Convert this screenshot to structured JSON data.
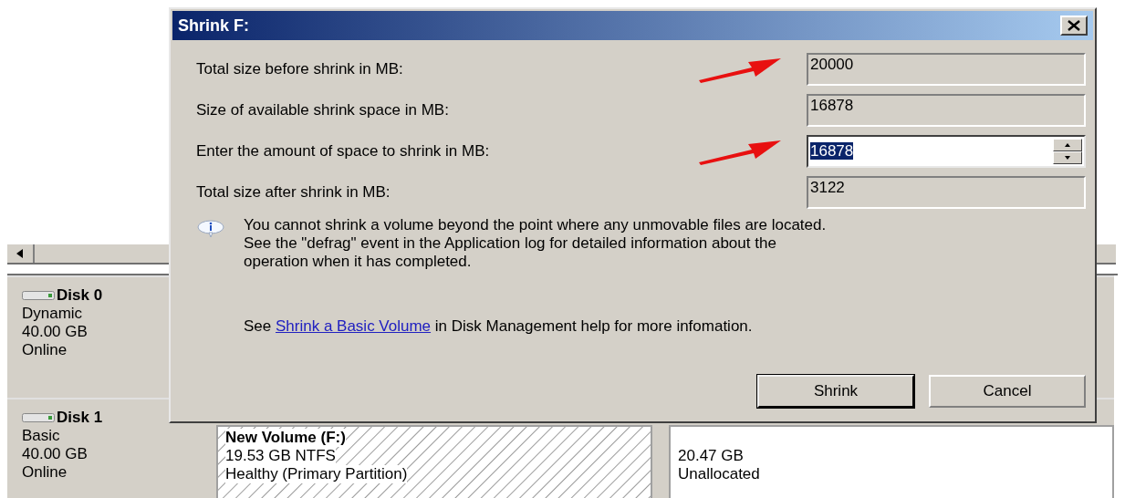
{
  "dialog": {
    "title": "Shrink F:",
    "fields": [
      {
        "label": "Total size before shrink in MB:",
        "value": "20000",
        "kind": "readonly",
        "arrow": true
      },
      {
        "label": "Size of available shrink space in MB:",
        "value": "16878",
        "kind": "readonly",
        "arrow": false
      },
      {
        "label": "Enter the amount of space to shrink in MB:",
        "value": "16878",
        "kind": "spin",
        "arrow": true
      },
      {
        "label": "Total size after shrink in MB:",
        "value": "3122",
        "kind": "readonly",
        "arrow": false
      }
    ],
    "note": [
      "You cannot shrink a volume beyond the point where any unmovable files are located.",
      "See the \"defrag\" event in the Application log for detailed information about the",
      "operation when it has completed."
    ],
    "help": {
      "before": "See",
      "link": "Shrink a Basic Volume",
      "after": "in Disk Management help for more infomation."
    },
    "buttons": [
      {
        "label": "Shrink",
        "default": true
      },
      {
        "label": "Cancel",
        "default": false
      }
    ]
  },
  "disks": [
    {
      "name": "Disk 0",
      "type": "Dynamic",
      "size": "40.00 GB",
      "status": "Online"
    },
    {
      "name": "Disk 1",
      "type": "Basic",
      "size": "40.00 GB",
      "status": "Online",
      "partitions": [
        {
          "kind": "volume",
          "title": "New Volume  (F:)",
          "size": "19.53 GB NTFS",
          "status": "Healthy (Primary Partition)"
        },
        {
          "kind": "unallocated",
          "size": "20.47 GB",
          "status": "Unallocated"
        }
      ]
    }
  ]
}
